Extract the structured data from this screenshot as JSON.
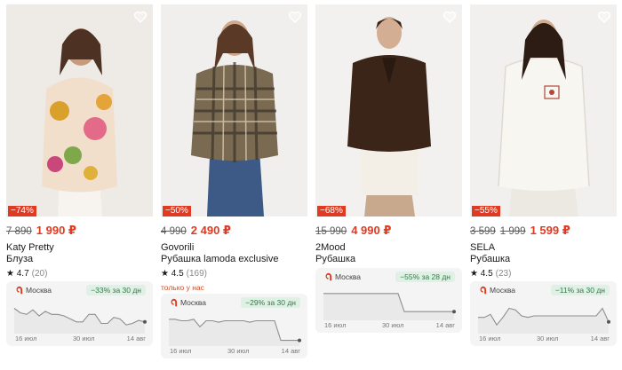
{
  "products": [
    {
      "discount": "−74%",
      "old_price": "7 890",
      "new_price": "1 990 ₽",
      "brand": "Katy Pretty",
      "name": "Блуза",
      "rating": "★ 4.7",
      "reviews": "(20)",
      "exclusive": "",
      "widget": {
        "city": "Москва",
        "drop": "−33% за 30 дн",
        "dates": [
          "16 июл",
          "30 июл",
          "14 авг"
        ],
        "price_trend": [
          0.75,
          0.6,
          0.55,
          0.7,
          0.5,
          0.65,
          0.55,
          0.55,
          0.5,
          0.4,
          0.3,
          0.3,
          0.55,
          0.55,
          0.25,
          0.25,
          0.45,
          0.4,
          0.2,
          0.25,
          0.35,
          0.3
        ]
      }
    },
    {
      "discount": "−50%",
      "old_price": "4 990",
      "new_price": "2 490 ₽",
      "brand": "Govorili",
      "name": "Рубашка lamoda exclusive",
      "rating": "★ 4.5",
      "reviews": "(169)",
      "exclusive": "только у нас",
      "widget": {
        "city": "Москва",
        "drop": "−29% за 30 дн",
        "dates": [
          "16 июл",
          "30 июл",
          "14 авг"
        ],
        "price_trend": [
          0.8,
          0.8,
          0.75,
          0.75,
          0.8,
          0.55,
          0.75,
          0.75,
          0.7,
          0.75,
          0.75,
          0.75,
          0.75,
          0.7,
          0.75,
          0.75,
          0.75,
          0.75,
          0.1,
          0.1,
          0.1,
          0.1
        ]
      }
    },
    {
      "discount": "−68%",
      "old_price": "15 990",
      "new_price": "4 990 ₽",
      "brand": "2Mood",
      "name": "Рубашка",
      "rating": "",
      "reviews": "",
      "exclusive": "",
      "widget": {
        "city": "Москва",
        "drop": "−55% за 28 дн",
        "dates": [
          "16 июл",
          "30 июл",
          "14 авг"
        ],
        "price_trend": [
          0.8,
          0.8,
          0.8,
          0.8,
          0.8,
          0.8,
          0.8,
          0.8,
          0.8,
          0.8,
          0.8,
          0.8,
          0.8,
          0.2,
          0.2,
          0.2,
          0.2,
          0.2,
          0.2,
          0.2,
          0.2,
          0.2
        ]
      }
    },
    {
      "discount": "−55%",
      "old_price": "3 599",
      "old_price_2": "1 999",
      "new_price": "1 599 ₽",
      "brand": "SELA",
      "name": "Рубашка",
      "rating": "★ 4.5",
      "reviews": "(23)",
      "exclusive": "",
      "widget": {
        "city": "Москва",
        "drop": "−11% за 30 дн",
        "dates": [
          "16 июл",
          "30 июл",
          "14 авг"
        ],
        "price_trend": [
          0.45,
          0.45,
          0.55,
          0.2,
          0.45,
          0.75,
          0.7,
          0.5,
          0.45,
          0.5,
          0.5,
          0.5,
          0.5,
          0.5,
          0.5,
          0.5,
          0.5,
          0.5,
          0.5,
          0.5,
          0.75,
          0.3
        ]
      }
    }
  ],
  "colors": {
    "accent": "#e03a22",
    "drop_green": "#2d7d45",
    "drop_bg": "#dff0e4",
    "widget_bg": "#f4f4f4"
  },
  "icons": {
    "favorite": "heart-outline-icon",
    "city": "lamoda-pin-icon",
    "rating": "star-icon"
  }
}
